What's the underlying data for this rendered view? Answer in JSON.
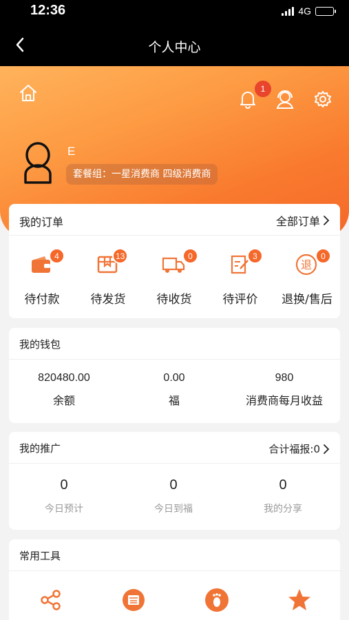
{
  "status_bar": {
    "time": "12:36",
    "network": "4G",
    "icons": [
      "signal-icon",
      "battery-icon"
    ]
  },
  "nav": {
    "title": "个人中心",
    "back_icon": "chevron-left-icon"
  },
  "header": {
    "icons": [
      "home-icon",
      "bell-icon",
      "customer-service-icon",
      "gear-icon"
    ],
    "notification_count": "1",
    "user_name": "E",
    "package_label": "套餐组：一星消费商 四级消费商"
  },
  "orders": {
    "title": "我的订单",
    "all_label": "全部订单",
    "items": [
      {
        "label": "待付款",
        "badge": "4",
        "icon": "wallet-icon"
      },
      {
        "label": "待发货",
        "badge": "13",
        "icon": "package-icon"
      },
      {
        "label": "待收货",
        "badge": "0",
        "icon": "truck-icon"
      },
      {
        "label": "待评价",
        "badge": "3",
        "icon": "review-icon"
      },
      {
        "label": "退换/售后",
        "badge": "0",
        "icon": "refund-icon"
      }
    ]
  },
  "wallet": {
    "title": "我的钱包",
    "stats": [
      {
        "value": "820480.00",
        "label": "余额"
      },
      {
        "value": "0.00",
        "label": "福"
      },
      {
        "value": "980",
        "label": "消费商每月收益"
      }
    ]
  },
  "promotion": {
    "title": "我的推广",
    "total_label": "合计福报:0",
    "stats": [
      {
        "value": "0",
        "label": "今日预计"
      },
      {
        "value": "0",
        "label": "今日到福"
      },
      {
        "value": "0",
        "label": "我的分享"
      }
    ]
  },
  "tools": {
    "title": "常用工具",
    "icons": [
      "share-icon",
      "card-icon",
      "footprint-icon",
      "star-icon"
    ]
  },
  "colors": {
    "accent": "#f5682a",
    "header_start": "#ffb35c",
    "header_end": "#f5682a",
    "nav_bg": "#000000",
    "page_bg": "#f3f3f3"
  }
}
